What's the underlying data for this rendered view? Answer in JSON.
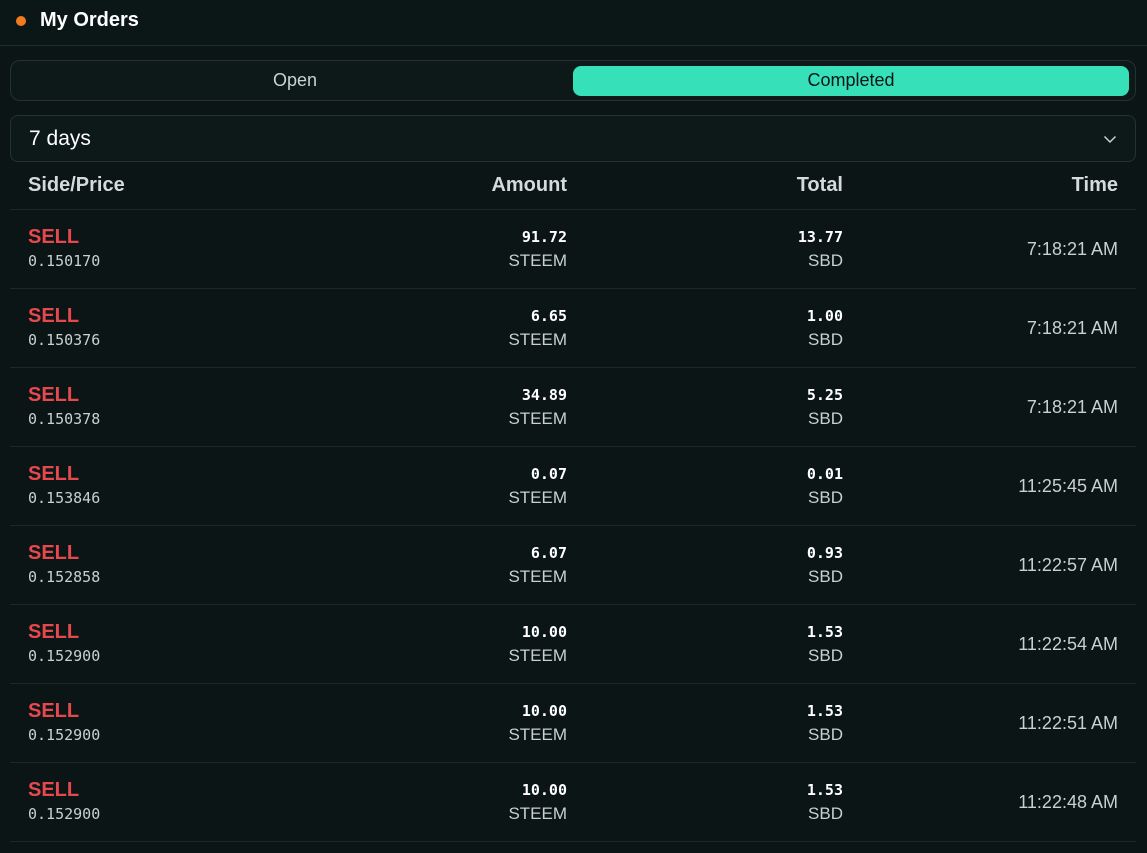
{
  "header": {
    "title": "My Orders",
    "dot_color": "#f47a20"
  },
  "tabs": [
    {
      "label": "Open",
      "active": false
    },
    {
      "label": "Completed",
      "active": true
    }
  ],
  "filter": {
    "value": "7 days",
    "icon": "chevron-down-icon"
  },
  "table": {
    "columns": [
      "Side/Price",
      "Amount",
      "Total",
      "Time"
    ],
    "rows": [
      {
        "side": "SELL",
        "price": "0.150170",
        "amount": "91.72",
        "amount_unit": "STEEM",
        "total": "13.77",
        "total_unit": "SBD",
        "time": "7:18:21 AM"
      },
      {
        "side": "SELL",
        "price": "0.150376",
        "amount": "6.65",
        "amount_unit": "STEEM",
        "total": "1.00",
        "total_unit": "SBD",
        "time": "7:18:21 AM"
      },
      {
        "side": "SELL",
        "price": "0.150378",
        "amount": "34.89",
        "amount_unit": "STEEM",
        "total": "5.25",
        "total_unit": "SBD",
        "time": "7:18:21 AM"
      },
      {
        "side": "SELL",
        "price": "0.153846",
        "amount": "0.07",
        "amount_unit": "STEEM",
        "total": "0.01",
        "total_unit": "SBD",
        "time": "11:25:45 AM"
      },
      {
        "side": "SELL",
        "price": "0.152858",
        "amount": "6.07",
        "amount_unit": "STEEM",
        "total": "0.93",
        "total_unit": "SBD",
        "time": "11:22:57 AM"
      },
      {
        "side": "SELL",
        "price": "0.152900",
        "amount": "10.00",
        "amount_unit": "STEEM",
        "total": "1.53",
        "total_unit": "SBD",
        "time": "11:22:54 AM"
      },
      {
        "side": "SELL",
        "price": "0.152900",
        "amount": "10.00",
        "amount_unit": "STEEM",
        "total": "1.53",
        "total_unit": "SBD",
        "time": "11:22:51 AM"
      },
      {
        "side": "SELL",
        "price": "0.152900",
        "amount": "10.00",
        "amount_unit": "STEEM",
        "total": "1.53",
        "total_unit": "SBD",
        "time": "11:22:48 AM"
      }
    ]
  },
  "colors": {
    "accent": "#36e0b8",
    "sell": "#e5484d",
    "background": "#0b1516"
  }
}
